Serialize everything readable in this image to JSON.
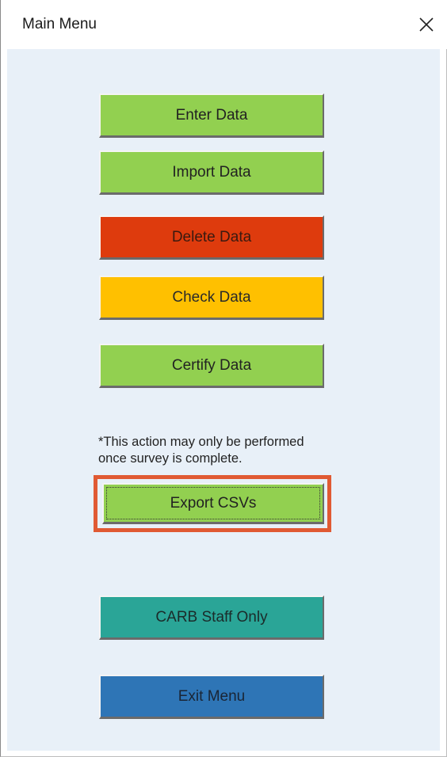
{
  "window": {
    "title": "Main Menu",
    "close_symbol": "close-icon"
  },
  "menu": {
    "enter_data": "Enter Data",
    "import_data": "Import Data",
    "delete_data": "Delete Data",
    "check_data": "Check Data",
    "certify_data": "Certify Data",
    "note_line1": "*This action may only be performed",
    "note_line2": "once survey is complete.",
    "export_csvs": "Export CSVs",
    "carb_staff_only": "CARB Staff Only",
    "exit_menu": "Exit Menu"
  },
  "colors": {
    "green": "#92d050",
    "red": "#de3b0d",
    "yellow": "#ffc000",
    "teal": "#2aa597",
    "blue": "#2e75b6",
    "highlight": "#e05a33",
    "client_bg": "#e8f0f8"
  }
}
